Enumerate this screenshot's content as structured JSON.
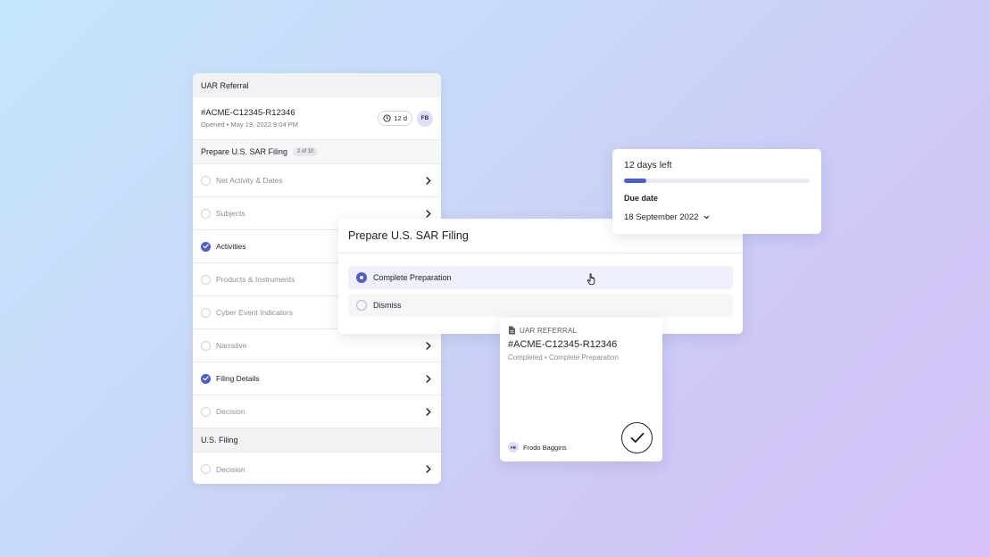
{
  "left_panel": {
    "header": "UAR Referral",
    "case": {
      "id": "#ACME-C12345-R12346",
      "status": "Opened",
      "opened_at": "May 19, 2022 9:04 PM",
      "timer": "12 d",
      "avatar": "FB"
    },
    "section": {
      "title": "Prepare U.S. SAR Filing",
      "count": "2 of 10"
    },
    "tasks": [
      {
        "label": "Net Activity & Dates",
        "done": false
      },
      {
        "label": "Subjects",
        "done": false
      },
      {
        "label": "Activities",
        "done": true
      },
      {
        "label": "Products & Instruments",
        "done": false
      },
      {
        "label": "Cyber Event Indicators",
        "done": false
      },
      {
        "label": "Narrative",
        "done": false
      },
      {
        "label": "Filing Details",
        "done": true
      },
      {
        "label": "Decision",
        "done": false
      }
    ],
    "group2": {
      "title": "U.S. Filing",
      "tasks": [
        {
          "label": "Decision",
          "done": false
        }
      ]
    }
  },
  "modal": {
    "title": "Prepare U.S. SAR Filing",
    "options": [
      {
        "label": "Complete Preparation",
        "selected": true
      },
      {
        "label": "Dismiss",
        "selected": false
      }
    ]
  },
  "due_card": {
    "days_left": "12 days left",
    "progress": 0.12,
    "due_label": "Due date",
    "due_date": "18 September 2022"
  },
  "referral_card": {
    "type": "UAR REFERRAL",
    "id": "#ACME-C12345-R12346",
    "status": "Completed",
    "outcome": "Complete Preparation",
    "owner_initials": "FB",
    "owner_name": "Frodo Baggins"
  },
  "colors": {
    "accent": "#4b5be0",
    "background_start": "#c5e6fb",
    "background_end": "#d6c2f7"
  }
}
